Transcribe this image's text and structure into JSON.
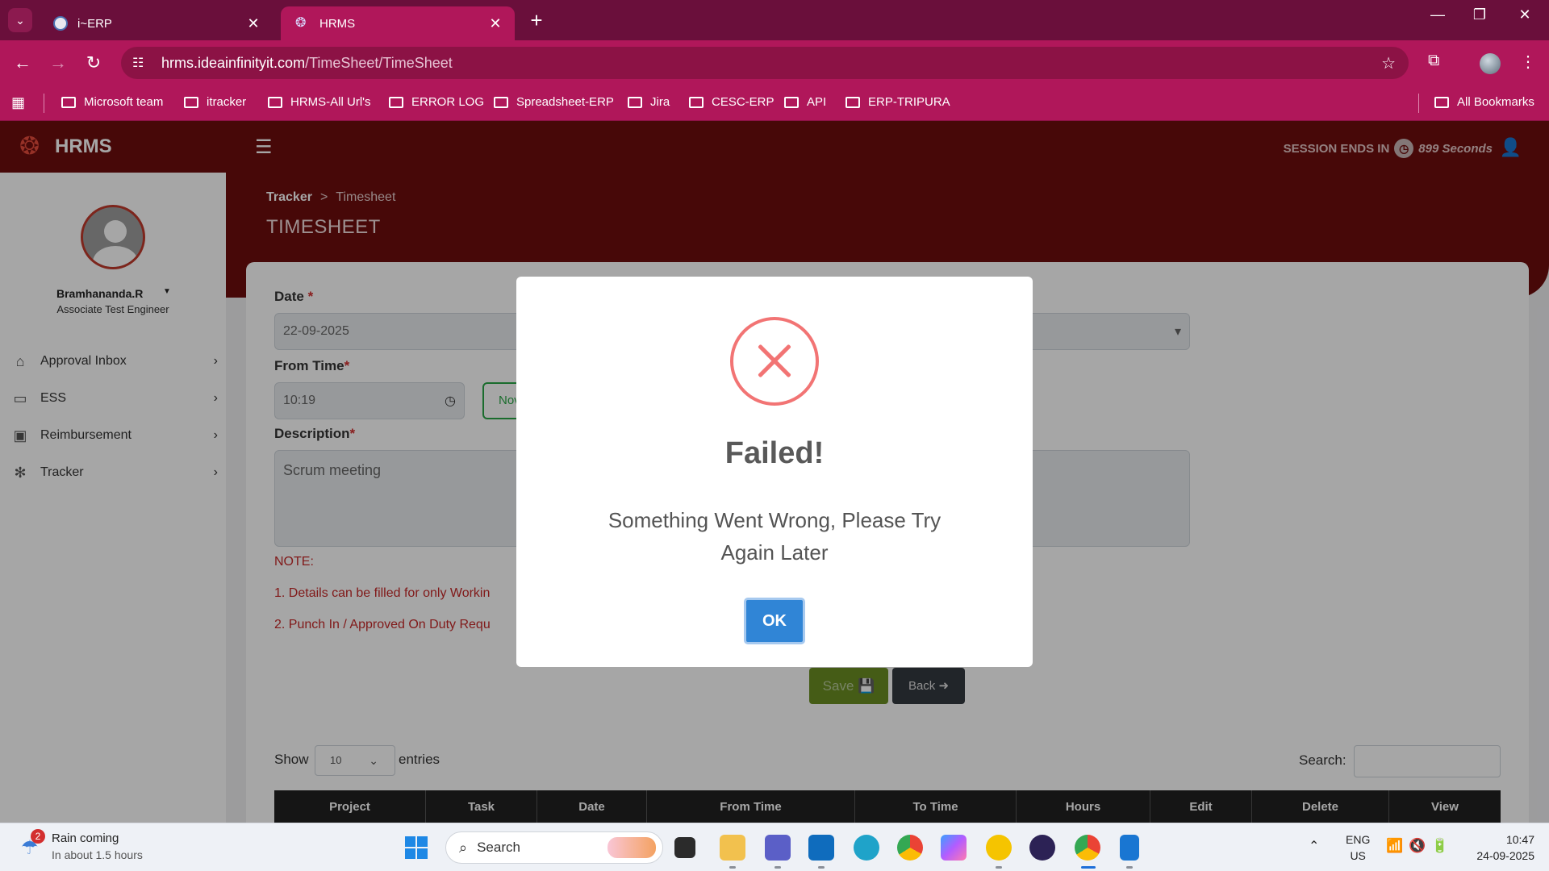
{
  "browser": {
    "tabs": [
      {
        "title": "i~ERP"
      },
      {
        "title": "HRMS"
      }
    ],
    "url_host": "hrms.ideainfinityit.com",
    "url_path": "/TimeSheet/TimeSheet",
    "bookmarks": [
      "Microsoft team",
      "itracker",
      "HRMS-All Url's",
      "ERROR LOG",
      "Spreadsheet-ERP",
      "Jira",
      "CESC-ERP",
      "API",
      "ERP-TRIPURA"
    ],
    "all_bookmarks": "All Bookmarks"
  },
  "app": {
    "title": "HRMS",
    "session_label": "SESSION ENDS IN",
    "session_value": "899 Seconds"
  },
  "sidebar": {
    "user_name": "Bramhananda.R",
    "user_role": "Associate Test Engineer",
    "items": [
      {
        "label": "Approval Inbox",
        "icon": "home-icon"
      },
      {
        "label": "ESS",
        "icon": "monitor-icon"
      },
      {
        "label": "Reimbursement",
        "icon": "money-icon"
      },
      {
        "label": "Tracker",
        "icon": "gear-icon"
      }
    ]
  },
  "page": {
    "breadcrumb_root": "Tracker",
    "breadcrumb_current": "Timesheet",
    "title": "TIMESHEET"
  },
  "form": {
    "date_label": "Date",
    "date_value": "22-09-2025",
    "from_time_label": "From Time",
    "from_time_value": "10:19",
    "now_label": "Nov",
    "description_label": "Description",
    "description_value": "Scrum meeting",
    "note_title": "NOTE:",
    "note_1": "1. Details can be filled for only Workin",
    "note_2": "2. Punch In / Approved On Duty Requ",
    "save_label": "Save",
    "back_label": "Back"
  },
  "table": {
    "show_label": "Show",
    "entries_value": "10",
    "entries_label": "entries",
    "search_label": "Search:",
    "columns": [
      "Project",
      "Task",
      "Date",
      "From Time",
      "To Time",
      "Hours",
      "Edit",
      "Delete",
      "View"
    ]
  },
  "modal": {
    "title": "Failed!",
    "message": "Something Went Wrong, Please Try Again Later",
    "ok_label": "OK"
  },
  "taskbar": {
    "weather_badge": "2",
    "weather_title": "Rain coming",
    "weather_sub": "In about 1.5 hours",
    "search_label": "Search",
    "lang_1": "ENG",
    "lang_2": "US",
    "time": "10:47",
    "date": "24-09-2025"
  },
  "colors": {
    "chrome_tabstrip": "#6a0f3b",
    "chrome_toolbar": "#b0175a",
    "app_header": "#6e0d0d",
    "error_red": "#f27474",
    "ok_blue": "#3085d6",
    "save_green": "#6b8e23"
  }
}
